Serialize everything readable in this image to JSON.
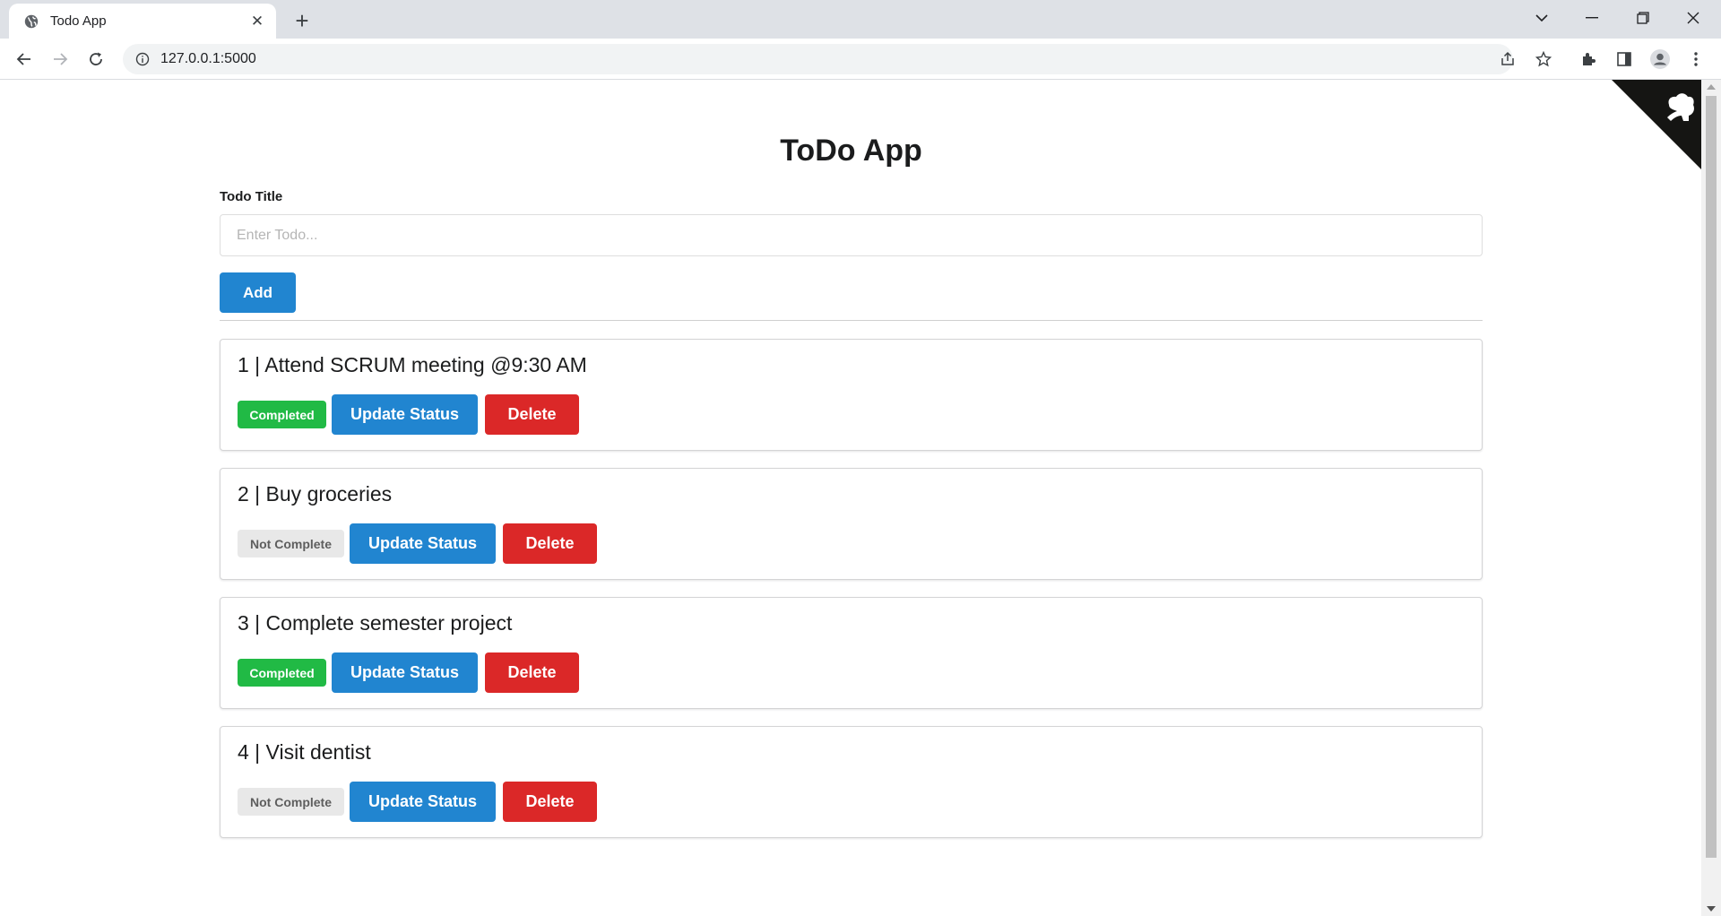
{
  "browser": {
    "tab_title": "Todo App",
    "tab_close": "✕",
    "new_tab": "+",
    "url": "127.0.0.1:5000"
  },
  "page": {
    "title": "ToDo App",
    "input_label": "Todo Title",
    "input_placeholder": "Enter Todo...",
    "add_label": "Add"
  },
  "todos": [
    {
      "heading": "1 | Attend SCRUM meeting @9:30 AM",
      "status": "Completed",
      "completed": true,
      "update_label": "Update Status",
      "delete_label": "Delete"
    },
    {
      "heading": "2 | Buy groceries",
      "status": "Not Complete",
      "completed": false,
      "update_label": "Update Status",
      "delete_label": "Delete"
    },
    {
      "heading": "3 | Complete semester project",
      "status": "Completed",
      "completed": true,
      "update_label": "Update Status",
      "delete_label": "Delete"
    },
    {
      "heading": "4 | Visit dentist",
      "status": "Not Complete",
      "completed": false,
      "update_label": "Update Status",
      "delete_label": "Delete"
    }
  ],
  "colors": {
    "primary": "#2185d0",
    "danger": "#db2828",
    "success": "#21ba45",
    "neutral": "#e8e8e8"
  }
}
